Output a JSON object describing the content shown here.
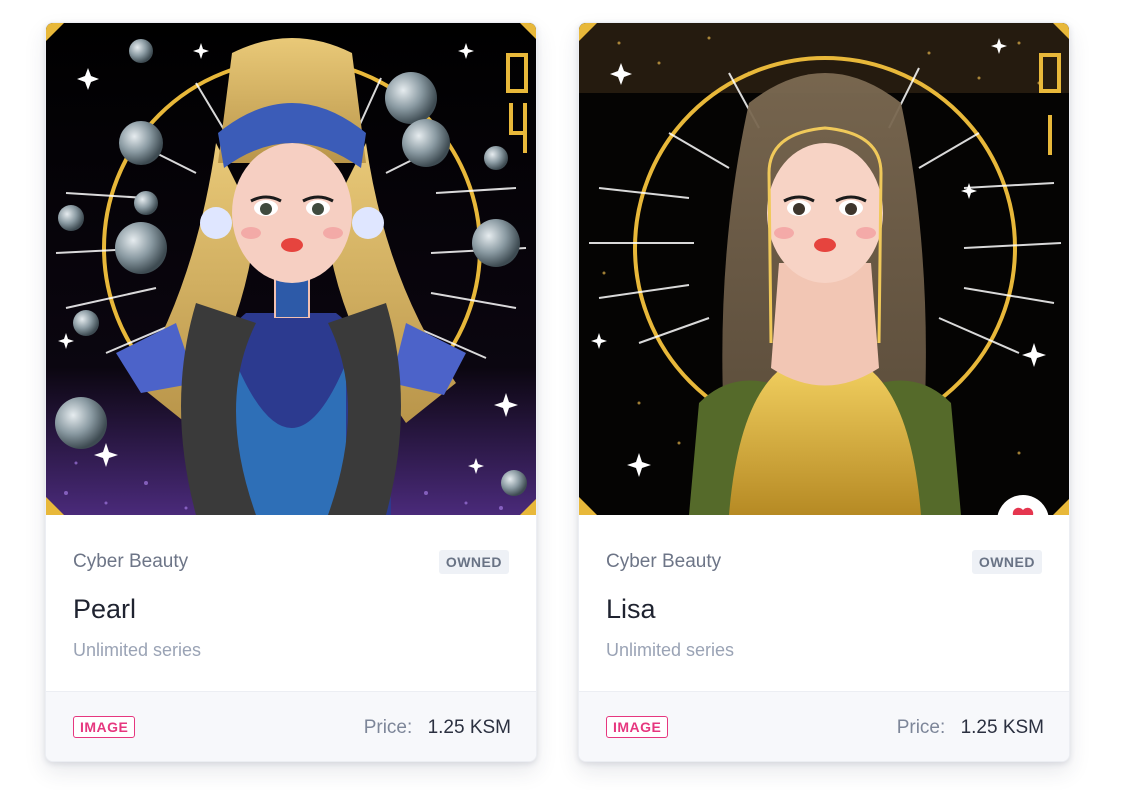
{
  "cards": [
    {
      "collection": "Cyber Beauty",
      "badge": "OWNED",
      "name": "Pearl",
      "series": "Unlimited series",
      "type": "IMAGE",
      "price_label": "Price:",
      "price_value": "1.25 KSM",
      "art_number": "04",
      "favorited": false
    },
    {
      "collection": "Cyber Beauty",
      "badge": "OWNED",
      "name": "Lisa",
      "series": "Unlimited series",
      "type": "IMAGE",
      "price_label": "Price:",
      "price_value": "1.25 KSM",
      "art_number": "01",
      "favorited": true
    }
  ],
  "colors": {
    "accent_pink": "#e6377f",
    "heart": "#e5364f",
    "gold_frame": "#e8b83a",
    "muted_text": "#6d7587"
  },
  "icons": {
    "favorite": "heart-icon"
  }
}
